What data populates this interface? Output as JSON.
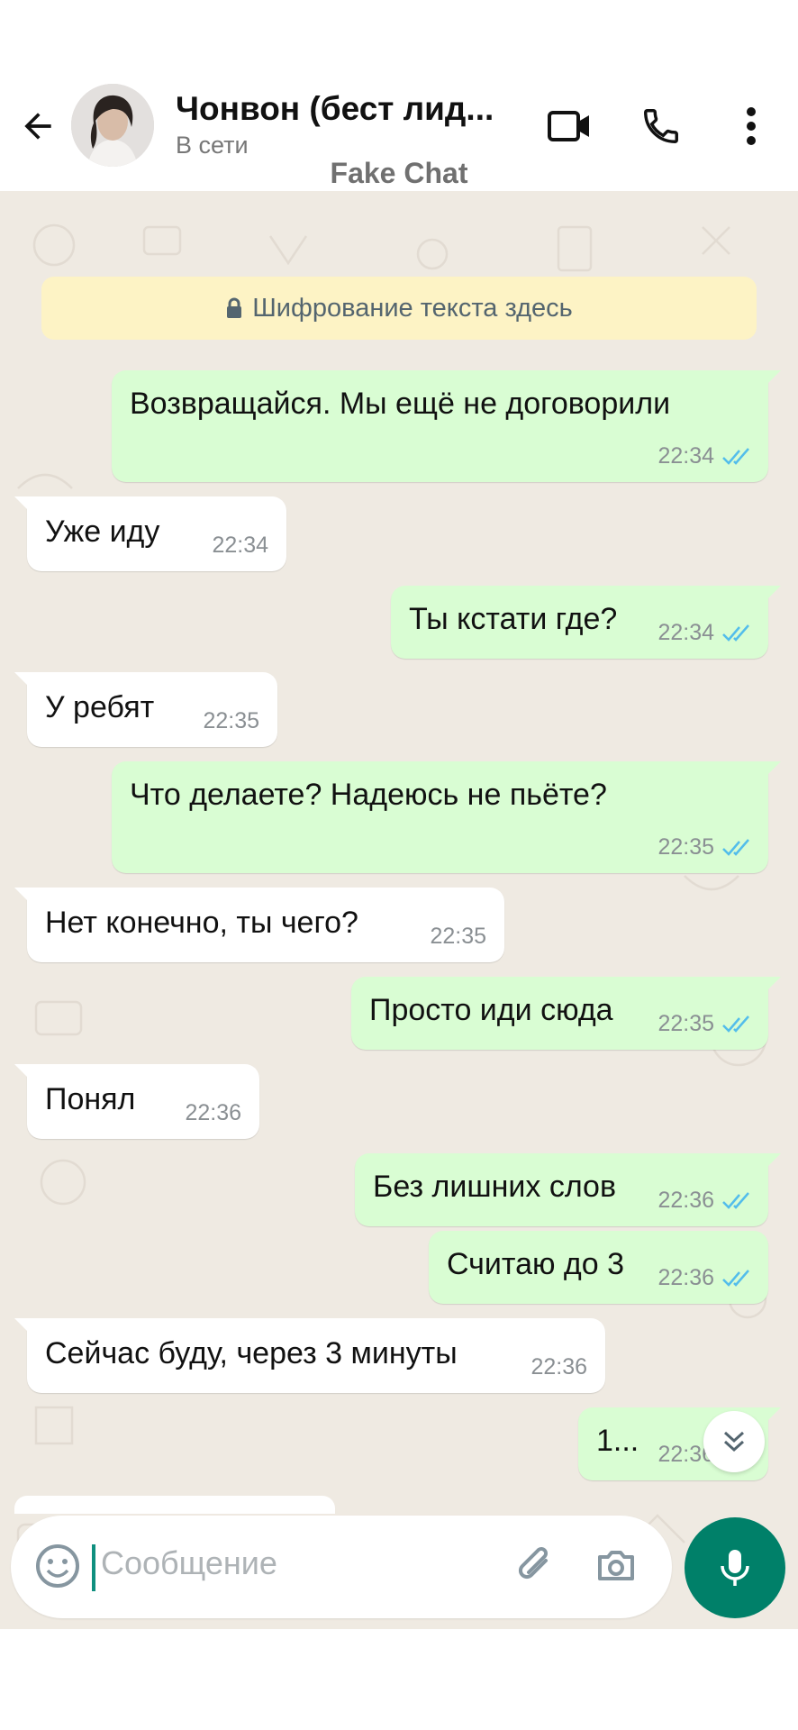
{
  "header": {
    "contact_name": "Чонвон (бест лид...",
    "status": "В сети",
    "watermark": "Fake Chat",
    "back_icon": "arrow-left-icon",
    "video_icon": "video-camera-icon",
    "call_icon": "phone-icon",
    "menu_icon": "more-vertical-icon"
  },
  "notice": {
    "text": "Шифрование текста здесь",
    "icon": "lock-icon"
  },
  "messages": [
    {
      "dir": "out",
      "text": "Возвращайся. Мы ещё не договорили",
      "time": "22:34",
      "read": true
    },
    {
      "dir": "in",
      "text": "Уже иду",
      "time": "22:34"
    },
    {
      "dir": "out",
      "text": "Ты кстати где?",
      "time": "22:34",
      "read": true
    },
    {
      "dir": "in",
      "text": "У ребят",
      "time": "22:35"
    },
    {
      "dir": "out",
      "text": "Что делаете? Надеюсь не пьёте?",
      "time": "22:35",
      "read": true
    },
    {
      "dir": "in",
      "text": "Нет конечно, ты чего?",
      "time": "22:35"
    },
    {
      "dir": "out",
      "text": "Просто иди сюда",
      "time": "22:35",
      "read": true
    },
    {
      "dir": "in",
      "text": "Понял",
      "time": "22:36"
    },
    {
      "dir": "out",
      "text": "Без лишних слов",
      "time": "22:36",
      "read": true
    },
    {
      "dir": "out",
      "text": "Считаю до 3",
      "time": "22:36",
      "read": true
    },
    {
      "dir": "in",
      "text": "Сейчас буду, через 3 минуты",
      "time": "22:36"
    },
    {
      "dir": "out",
      "text": "1...",
      "time": "22:36",
      "read": true
    }
  ],
  "composer": {
    "placeholder": "Сообщение"
  },
  "colors": {
    "accent": "#008069",
    "outgoing_bubble": "#d9fdd3",
    "incoming_bubble": "#ffffff",
    "chat_bg": "#efeae2",
    "read_ticks": "#53bdeb"
  }
}
